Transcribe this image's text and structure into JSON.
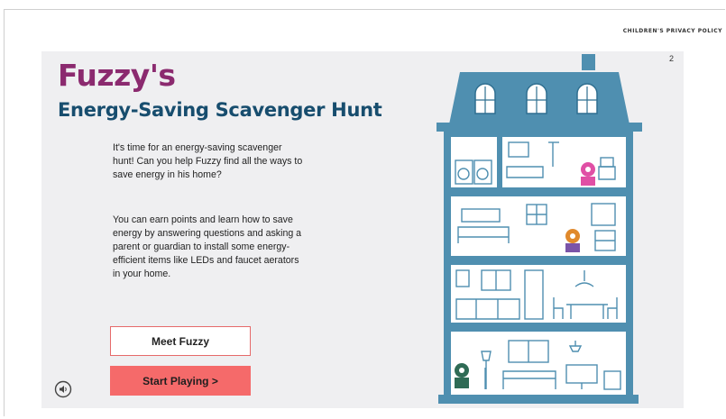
{
  "header": {
    "privacy_link": "CHILDREN'S PRIVACY POLICY"
  },
  "page": {
    "number": "2"
  },
  "title": {
    "line1": "Fuzzy's",
    "line2": "Energy-Saving Scavenger Hunt"
  },
  "intro": {
    "paragraph1": "It's time for an energy-saving scavenger hunt! Can you help Fuzzy find all the ways to save energy in his home?",
    "paragraph2": "You can earn points and learn how to save energy by answering questions and asking a parent or guardian to install some energy-efficient items like LEDs and faucet aerators in your home."
  },
  "buttons": {
    "meet": "Meet Fuzzy",
    "start": "Start Playing >"
  },
  "icons": {
    "sound": "sound-icon",
    "house": "house-illustration"
  },
  "colors": {
    "title_purple": "#8b2a6f",
    "title_blue": "#174d6e",
    "accent_red": "#f56a6a",
    "house_blue": "#4f8fb0",
    "panel_bg": "#efeff1"
  }
}
